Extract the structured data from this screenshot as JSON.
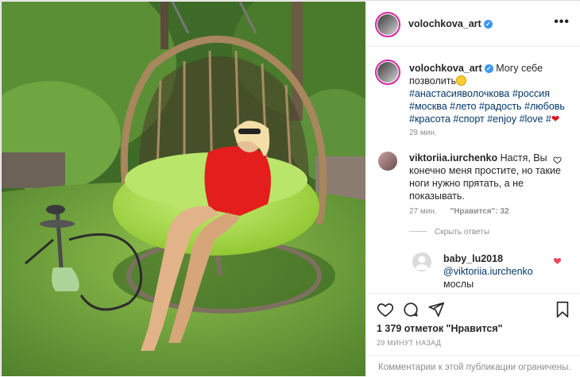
{
  "post": {
    "author": "volochkova_art",
    "caption_text": "Могу себе позволить",
    "hashtags": [
      "#анастасияволочкова",
      "#россия",
      "#москва",
      "#лето",
      "#радость",
      "#любовь",
      "#красота",
      "#спорт",
      "#enjoy",
      "#love",
      "#"
    ],
    "caption_emoji": "grinning-face",
    "caption_time": "29 мин.",
    "likes": "1 379 отметок \"Нравится\"",
    "posted_ago": "29 МИНУТ НАЗАД",
    "comments_closed": "Комментарии к этой публикации ограничены."
  },
  "header": {
    "username": "volochkova_art",
    "more_label": "•••"
  },
  "comments": [
    {
      "username": "viktoriia.iurchenko",
      "text": "Настя, Вы конечно меня простите, но такие ноги нужно прятать, а не показывать.",
      "time": "27 мин.",
      "likes_label": "\"Нравится\": 32",
      "liked": false
    }
  ],
  "replies_toggle": "Скрыть ответы",
  "replies": [
    {
      "username": "baby_lu2018",
      "mention": "@viktoriia.iurchenko",
      "text": "мослы",
      "liked": true
    }
  ],
  "colors": {
    "link": "#00376b",
    "verified": "#3897f0",
    "heart": "#ed4956",
    "muted": "#8e8e8e"
  },
  "icons": [
    "verified-icon",
    "more-icon",
    "heart-icon",
    "comment-icon",
    "share-icon",
    "bookmark-icon"
  ]
}
